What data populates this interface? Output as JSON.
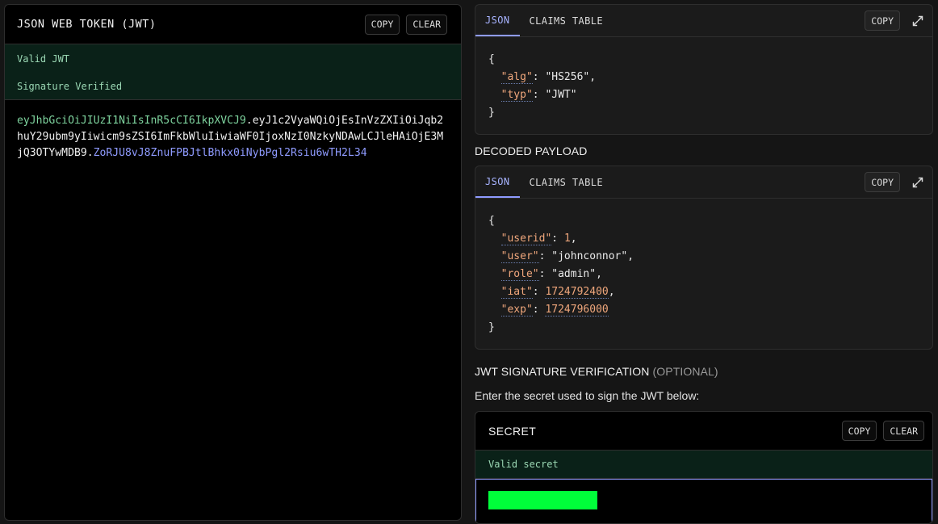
{
  "encoder": {
    "title": "JSON WEB TOKEN (JWT)",
    "copy_label": "COPY",
    "clear_label": "CLEAR",
    "status_valid": "Valid JWT",
    "status_signature": "Signature Verified",
    "token_header": "eyJhbGciOiJIUzI1NiIsInR5cCI6IkpXVCJ9",
    "token_payload": "eyJ1c2VyaWQiOjEsInVzZXIiOiJqb2huY29ubm9yIiwicm9sZSI6ImFkbWluIiwiaWF0IjoxNzI0NzkyNDAwLCJleHAiOjE3MjQ3OTYwMDB9",
    "token_signature": "ZoRJU8vJ8ZnuFPBJtlBhkx0iNybPgl2Rsiu6wTH2L34",
    "dot": "."
  },
  "header_card": {
    "tab_json": "JSON",
    "tab_claims": "CLAIMS TABLE",
    "copy_label": "COPY",
    "fields": {
      "alg": "HS256",
      "typ": "JWT"
    }
  },
  "payload_section": {
    "label": "DECODED PAYLOAD",
    "tab_json": "JSON",
    "tab_claims": "CLAIMS TABLE",
    "copy_label": "COPY",
    "fields": {
      "userid": 1,
      "user": "johnconnor",
      "role": "admin",
      "iat": 1724792400,
      "exp": 1724796000
    }
  },
  "verification": {
    "title": "JWT SIGNATURE VERIFICATION",
    "title_suffix": "(OPTIONAL)",
    "helper": "Enter the secret used to sign the JWT below:",
    "secret_title": "SECRET",
    "copy_label": "COPY",
    "clear_label": "CLEAR",
    "secret_status": "Valid secret"
  },
  "colors": {
    "valid_bg": "#0a2118",
    "header_segment": "#7ed39e",
    "signature_segment": "#8f9bff",
    "secret_highlight": "#00ff3a"
  },
  "icons": [
    "expand-icon"
  ]
}
